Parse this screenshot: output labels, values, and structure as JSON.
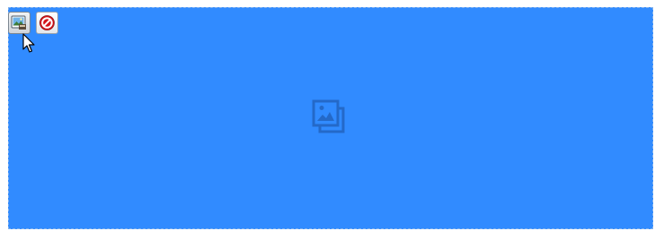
{
  "editor": {
    "background_color": "#318bff",
    "border_color": "#7fb0ee",
    "toolbar": {
      "buttons": [
        {
          "name": "change-image-button",
          "icon": "image-edit-icon",
          "state": "hovered"
        },
        {
          "name": "remove-image-button",
          "icon": "no-entry-icon",
          "state": "normal"
        }
      ]
    },
    "placeholder": {
      "icon": "image-placeholder-icon",
      "color": "#2469c8"
    }
  }
}
